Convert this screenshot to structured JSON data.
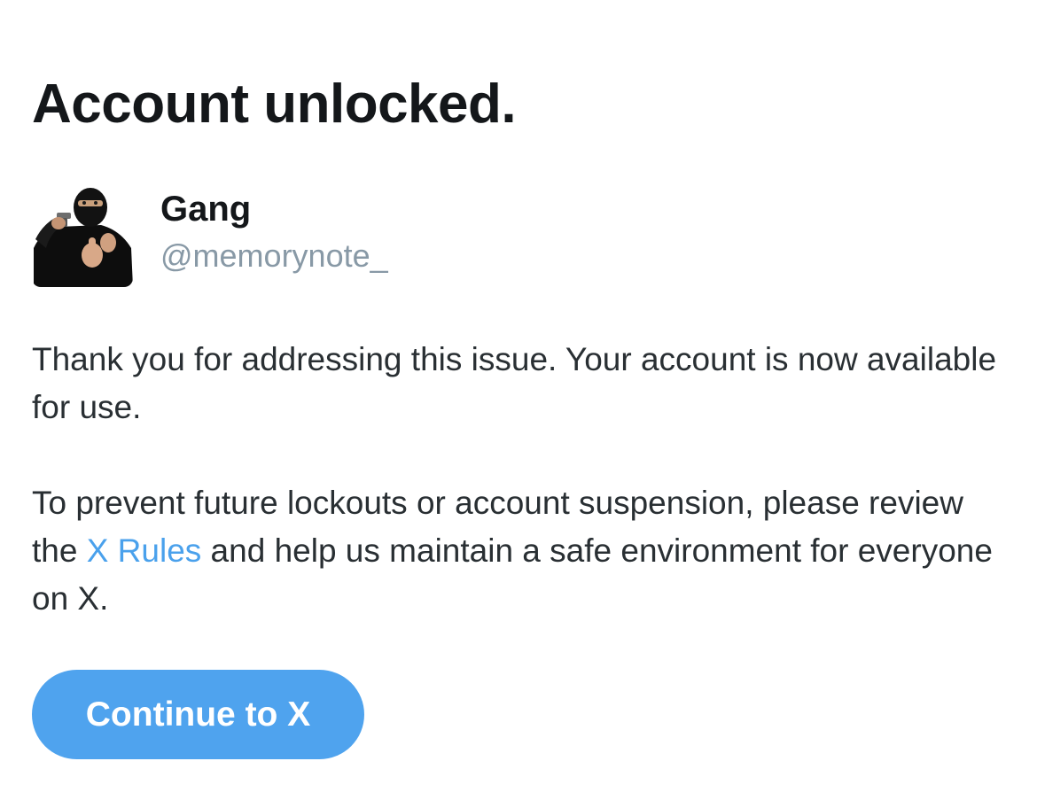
{
  "page": {
    "title": "Account unlocked."
  },
  "account": {
    "display_name": "Gang",
    "handle": "@memorynote_",
    "avatar_icon": "masked-person-avatar"
  },
  "message": {
    "paragraph_1": "Thank you for addressing this issue. Your account is now available for use.",
    "paragraph_2_before_link": "To prevent future lockouts or account suspension, please review the ",
    "rules_link_label": "X Rules",
    "paragraph_2_after_link": " and help us maintain a safe environment for everyone on X."
  },
  "actions": {
    "continue_label": "Continue to X"
  },
  "colors": {
    "heading": "#14171a",
    "body_text": "#292f33",
    "handle": "#8899a6",
    "link": "#4aa1ec",
    "button_background": "#4fa3ee",
    "button_text": "#ffffff"
  }
}
